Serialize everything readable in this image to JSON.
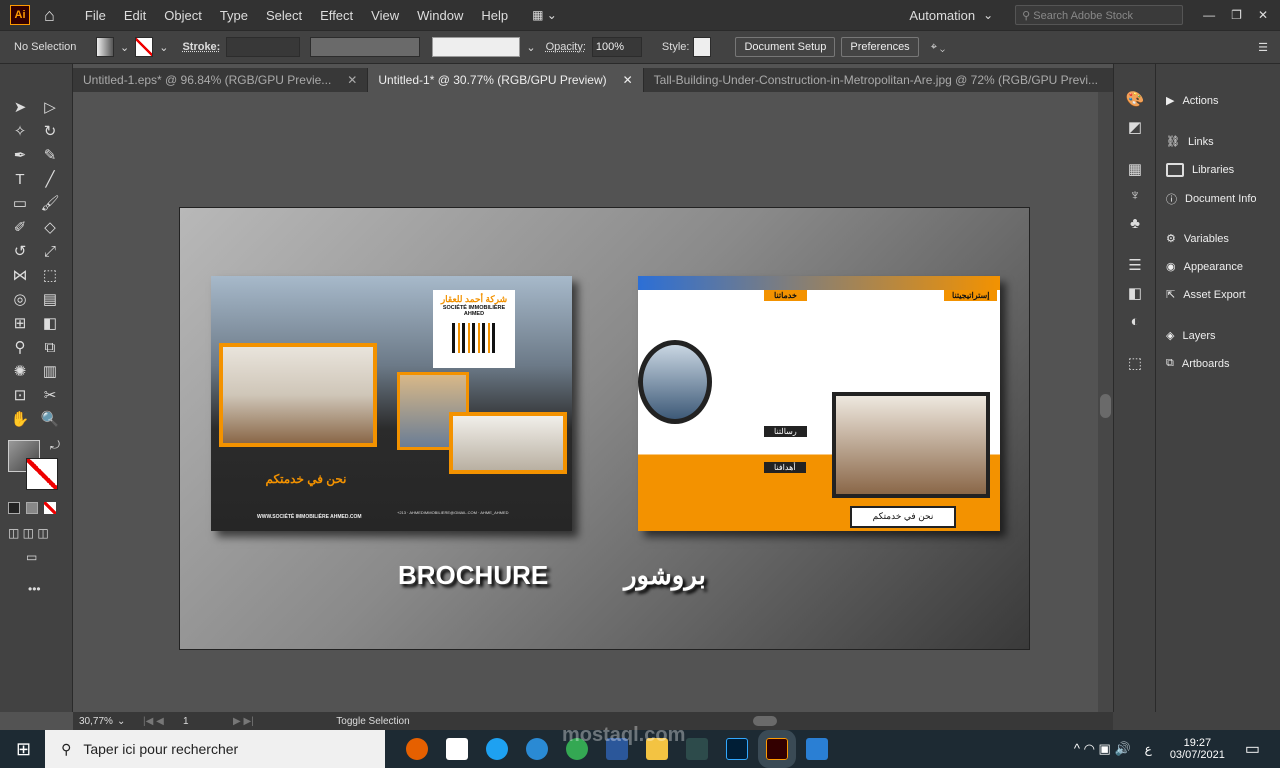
{
  "app": {
    "logo": "Ai",
    "menu": [
      "File",
      "Edit",
      "Object",
      "Type",
      "Select",
      "Effect",
      "View",
      "Window",
      "Help"
    ],
    "workspace": "Automation",
    "search_placeholder": "Search Adobe Stock"
  },
  "control": {
    "selection": "No Selection",
    "stroke_label": "Stroke:",
    "opacity_label": "Opacity:",
    "opacity_value": "100%",
    "style_label": "Style:",
    "document_setup": "Document Setup",
    "preferences": "Preferences"
  },
  "tabs": [
    {
      "label": "Untitled-1.eps* @ 96.84% (RGB/GPU Previe...",
      "active": false
    },
    {
      "label": "Untitled-1* @ 30.77% (RGB/GPU Preview)",
      "active": true
    },
    {
      "label": "Tall-Building-Under-Construction-in-Metropolitan-Are.jpg @ 72% (RGB/GPU Previ...",
      "active": false
    }
  ],
  "artwork": {
    "brochure_latin": "BROCHURE",
    "brochure_arabic": "بروشور",
    "company_ar": "شركة أحمد للعقار",
    "company_fr": "SOCIÉTÉ IMMOBILIÈRE AHMED",
    "slogan": "نحن في خدمتكم",
    "website": "WWW.SOCIÉTÉ IMMOBILIÈRE AHMED.COM",
    "sections": [
      "خدماتنا",
      "إستراتيجيتنا",
      "رسالتنا",
      "أهدافنا"
    ],
    "accent": "#f39200"
  },
  "panels": [
    "Actions",
    "Links",
    "Libraries",
    "Document Info",
    "Variables",
    "Appearance",
    "Asset Export",
    "Layers",
    "Artboards"
  ],
  "status": {
    "zoom": "30,77%",
    "artboard": "1",
    "action": "Toggle Selection"
  },
  "taskbar": {
    "search_placeholder": "Taper ici pour rechercher",
    "time": "19:27",
    "date": "03/07/2021",
    "lang": "ع"
  },
  "watermark": "mostaql.com"
}
